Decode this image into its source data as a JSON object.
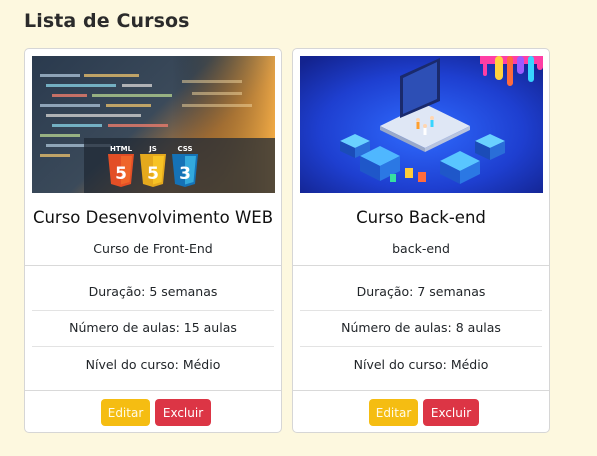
{
  "page": {
    "title": "Lista de Cursos"
  },
  "courses": [
    {
      "image": "html5-css3-js-code-image",
      "title": "Curso Desenvolvimento WEB",
      "subtitle": "Curso de Front-End",
      "duration": "Duração: 5 semanas",
      "lessons": "Número de aulas: 15 aulas",
      "level": "Nível do curso: Médio",
      "badges": [
        "HTML",
        "JS",
        "CSS"
      ],
      "edit_label": "Editar",
      "delete_label": "Excluir"
    },
    {
      "image": "isometric-laptop-backend-image",
      "title": "Curso Back-end",
      "subtitle": "back-end",
      "duration": "Duração: 7 semanas",
      "lessons": "Número de aulas: 8 aulas",
      "level": "Nível do curso: Médio",
      "edit_label": "Editar",
      "delete_label": "Excluir"
    }
  ],
  "colors": {
    "background": "#fdf8df",
    "edit_button": "#f5bd12",
    "delete_button": "#dc3545"
  }
}
